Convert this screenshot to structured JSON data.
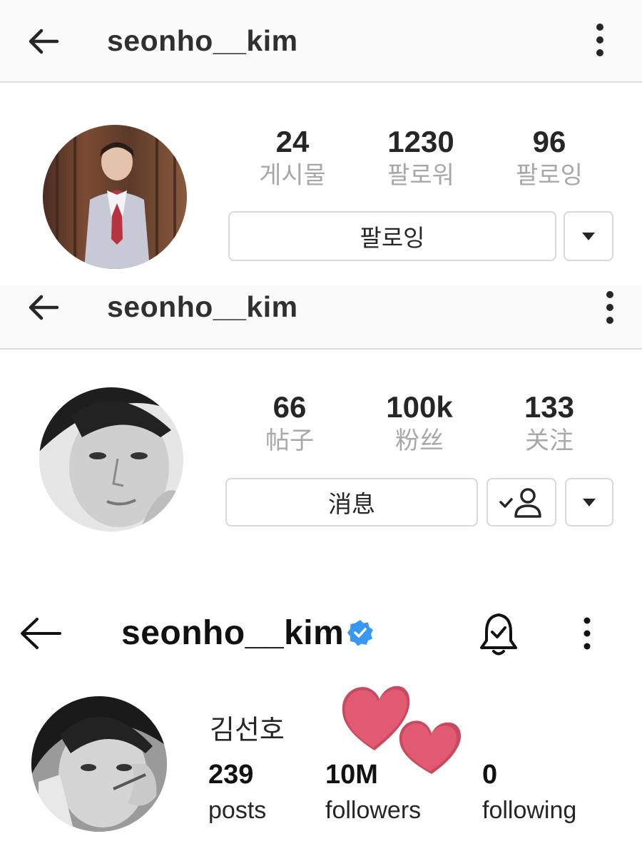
{
  "screens": [
    {
      "username": "seonho__kim",
      "stats": [
        {
          "value": "24",
          "label": "게시물"
        },
        {
          "value": "1230",
          "label": "팔로워"
        },
        {
          "value": "96",
          "label": "팔로잉"
        }
      ],
      "primary_button": "팔로잉"
    },
    {
      "username": "seonho__kim",
      "stats": [
        {
          "value": "66",
          "label": "帖子"
        },
        {
          "value": "100k",
          "label": "粉丝"
        },
        {
          "value": "133",
          "label": "关注"
        }
      ],
      "primary_button": "消息"
    },
    {
      "username": "seonho__kim",
      "full_name": "김선호",
      "stats": [
        {
          "value": "239",
          "label": "posts"
        },
        {
          "value": "10M",
          "label": "followers"
        },
        {
          "value": "0",
          "label": "following"
        }
      ]
    }
  ],
  "icons": {
    "back": "arrow-left-icon",
    "more": "vertical-dots-icon",
    "dropdown": "caret-down-icon",
    "following_status": "person-check-icon",
    "verified": "verified-badge-icon",
    "notifications": "bell-check-icon",
    "decoration": "hearts-sticker"
  },
  "colors": {
    "verified_blue": "#3897f0",
    "heart_pink": "#e25a72",
    "label_gray": "#a8a8a8",
    "border_gray": "#d9d9d9"
  }
}
